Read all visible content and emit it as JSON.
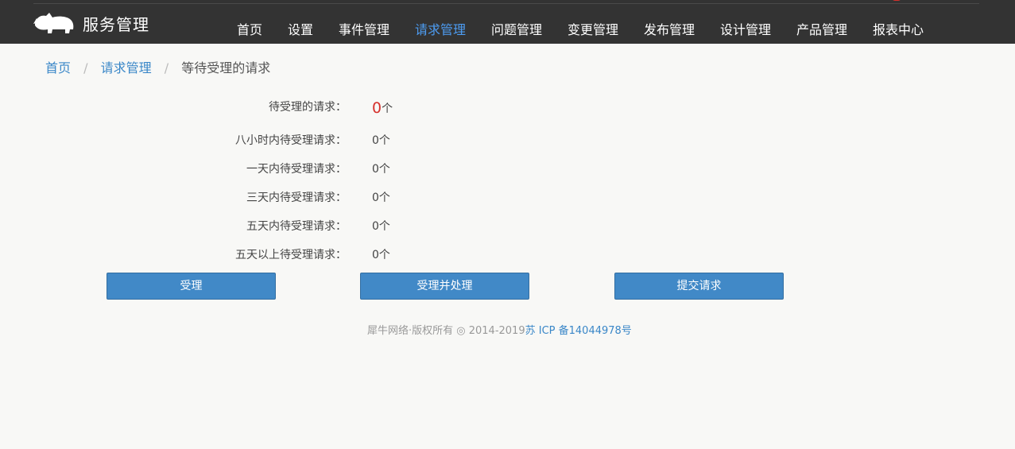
{
  "brand": {
    "title": "服务管理",
    "logo_icon": "rhino-logo-icon"
  },
  "nav": {
    "items": [
      {
        "label": "首页",
        "active": false
      },
      {
        "label": "设置",
        "active": false
      },
      {
        "label": "事件管理",
        "active": false
      },
      {
        "label": "请求管理",
        "active": true
      },
      {
        "label": "问题管理",
        "active": false
      },
      {
        "label": "变更管理",
        "active": false
      },
      {
        "label": "发布管理",
        "active": false
      },
      {
        "label": "设计管理",
        "active": false
      },
      {
        "label": "产品管理",
        "active": false
      },
      {
        "label": "报表中心",
        "active": false
      }
    ]
  },
  "breadcrumb": {
    "items": [
      "首页",
      "请求管理",
      "等待受理的请求"
    ],
    "separator": "/"
  },
  "stats": [
    {
      "label": "待受理的请求：",
      "value": "0",
      "unit": "个"
    },
    {
      "label": "八小时内待受理请求：",
      "value": "0",
      "unit": "个"
    },
    {
      "label": "一天内待受理请求：",
      "value": "0",
      "unit": "个"
    },
    {
      "label": "三天内待受理请求：",
      "value": "0",
      "unit": "个"
    },
    {
      "label": "五天内待受理请求：",
      "value": "0",
      "unit": "个"
    },
    {
      "label": "五天以上待受理请求：",
      "value": "0",
      "unit": "个"
    }
  ],
  "actions": {
    "accept_label": "受理",
    "accept_process_label": "受理并处理",
    "submit_label": "提交请求"
  },
  "footer": {
    "copyright": "犀牛网络·版权所有 ◎ 2014-2019",
    "icp": "苏 ICP 备14044978号"
  },
  "colors": {
    "navbar_bg": "#333333",
    "nav_active": "#4d9cf2",
    "link": "#3a87c8",
    "button": "#4189c7",
    "highlight_red": "#d6312c"
  }
}
